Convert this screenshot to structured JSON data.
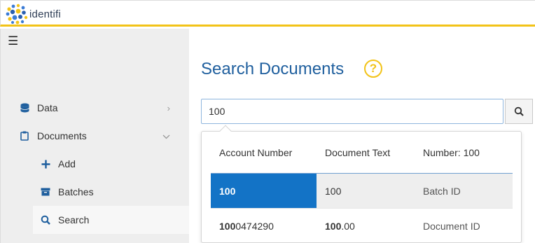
{
  "header": {
    "logo_text": "identifi"
  },
  "sidebar": {
    "menu_icon": "hamburger-icon",
    "items": [
      {
        "label": "Data",
        "icon": "database-icon",
        "chevron": "chevron-right-icon"
      },
      {
        "label": "Documents",
        "icon": "clipboard-icon",
        "chevron": "chevron-down-icon"
      }
    ],
    "subitems": [
      {
        "label": "Add",
        "icon": "plus-icon"
      },
      {
        "label": "Batches",
        "icon": "archive-icon"
      },
      {
        "label": "Search",
        "icon": "search-icon",
        "active": true
      }
    ]
  },
  "main": {
    "title": "Search Documents",
    "help_symbol": "?",
    "search": {
      "value": "100",
      "placeholder": ""
    }
  },
  "suggestions": {
    "columns": [
      "Account Number",
      "Document Text",
      "Number: 100"
    ],
    "rows": [
      {
        "match": "100",
        "rest": "",
        "text_match": "100",
        "text_rest": "",
        "type": "Batch ID",
        "selected": true
      },
      {
        "match": "100",
        "rest": "0474290",
        "text_match": "100",
        "text_rest": ".00",
        "type": "Document ID",
        "selected": false
      }
    ]
  },
  "colors": {
    "accent_yellow": "#f2c318",
    "title_blue": "#1f5f9e",
    "selected_blue": "#1373c6"
  }
}
